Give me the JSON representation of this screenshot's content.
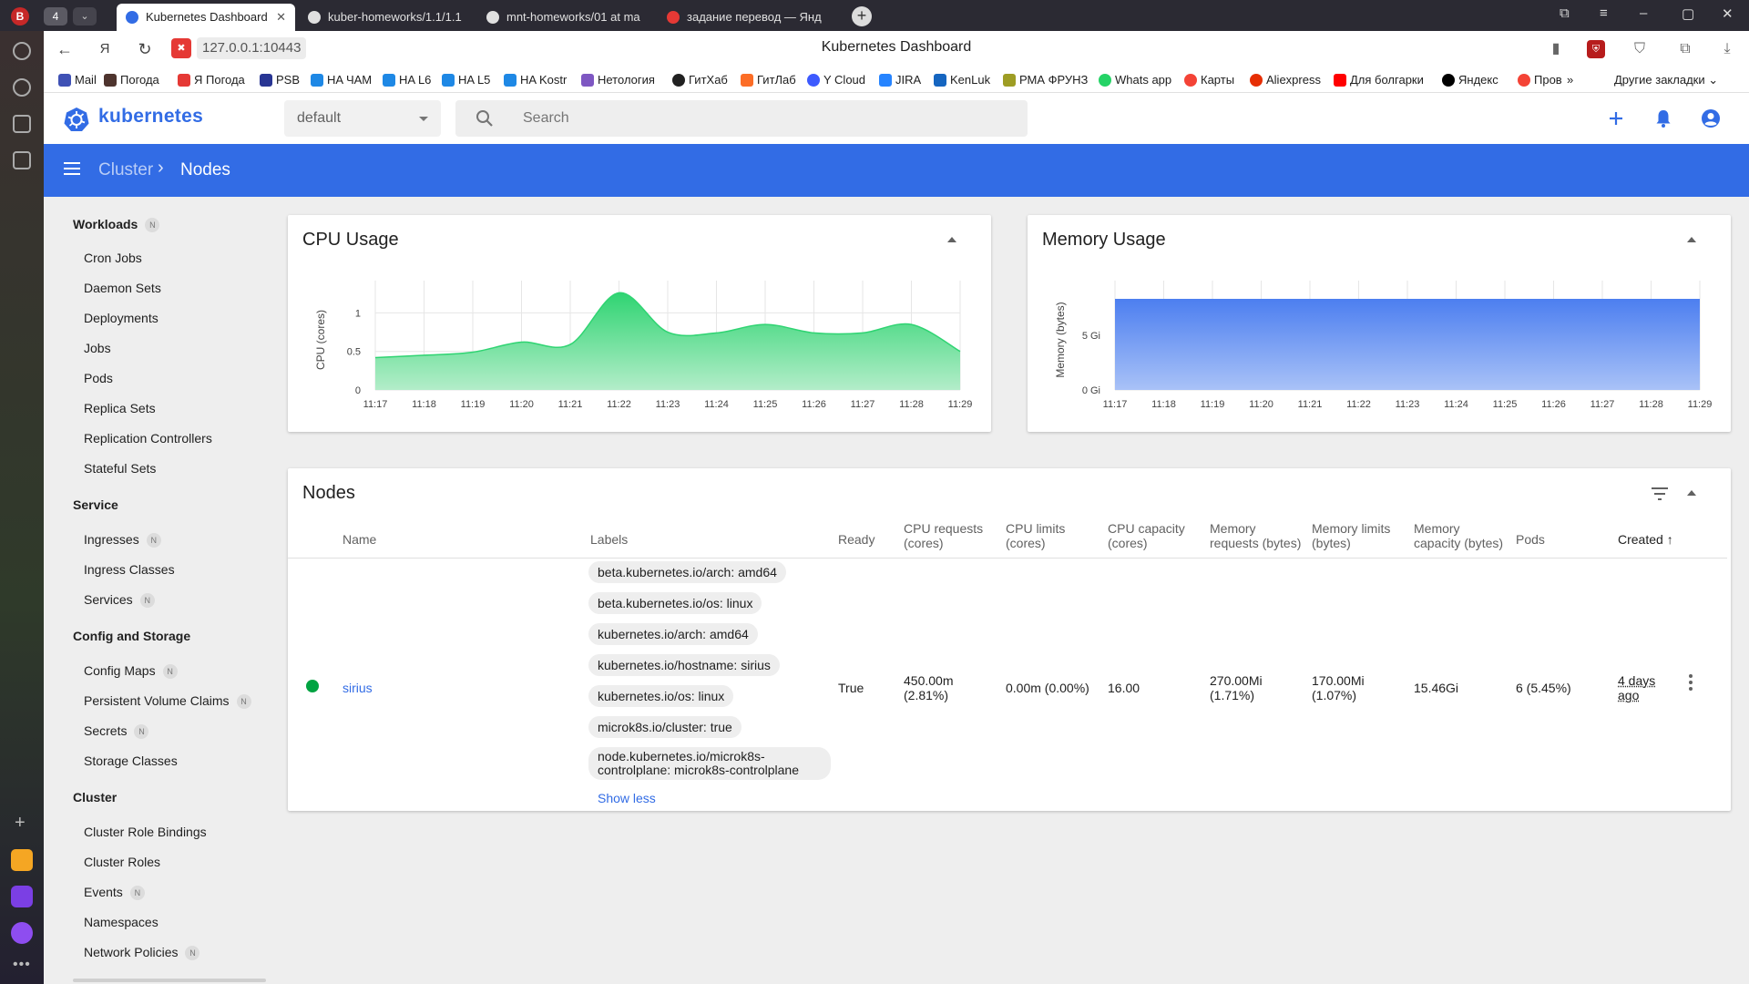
{
  "browser": {
    "profile_letter": "B",
    "tab_count": "4",
    "tabs": [
      {
        "label": "Kubernetes Dashboard",
        "active": true
      },
      {
        "label": "kuber-homeworks/1.1/1.1",
        "active": false
      },
      {
        "label": "mnt-homeworks/01 at ma",
        "active": false
      },
      {
        "label": "задание перевод — Янд",
        "active": false
      }
    ],
    "url": "127.0.0.1:10443",
    "page_title": "Kubernetes Dashboard",
    "bookmarks": [
      "Mail",
      "Погода",
      "Я Погода",
      "PSB",
      "HA ЧАМ",
      "HA L6",
      "HA L5",
      "HA Kostr",
      "Нетология",
      "ГитХаб",
      "ГитЛаб",
      "Y Cloud",
      "JIRA",
      "KenLuk",
      "РМА ФРУНЗ",
      "Whats app",
      "Карты",
      "Aliexpress",
      "Для болгарки",
      "Яндекс",
      "Пров"
    ],
    "bookmarks_more": "»",
    "other_bookmarks": "Другие закладки"
  },
  "app": {
    "brand": "kubernetes",
    "namespace": "default",
    "search_placeholder": "Search",
    "breadcrumb": {
      "parent": "Cluster",
      "separator": "›",
      "current": "Nodes"
    }
  },
  "sidebar": {
    "sections": [
      {
        "title": "Workloads",
        "badge": "N",
        "items": [
          {
            "label": "Cron Jobs"
          },
          {
            "label": "Daemon Sets"
          },
          {
            "label": "Deployments"
          },
          {
            "label": "Jobs"
          },
          {
            "label": "Pods"
          },
          {
            "label": "Replica Sets"
          },
          {
            "label": "Replication Controllers"
          },
          {
            "label": "Stateful Sets"
          }
        ]
      },
      {
        "title": "Service",
        "items": [
          {
            "label": "Ingresses",
            "badge": "N"
          },
          {
            "label": "Ingress Classes"
          },
          {
            "label": "Services",
            "badge": "N"
          }
        ]
      },
      {
        "title": "Config and Storage",
        "items": [
          {
            "label": "Config Maps",
            "badge": "N"
          },
          {
            "label": "Persistent Volume Claims",
            "badge": "N"
          },
          {
            "label": "Secrets",
            "badge": "N"
          },
          {
            "label": "Storage Classes"
          }
        ]
      },
      {
        "title": "Cluster",
        "items": [
          {
            "label": "Cluster Role Bindings"
          },
          {
            "label": "Cluster Roles"
          },
          {
            "label": "Events",
            "badge": "N"
          },
          {
            "label": "Namespaces"
          },
          {
            "label": "Network Policies",
            "badge": "N"
          }
        ]
      }
    ]
  },
  "chart_data": [
    {
      "type": "area",
      "title": "CPU Usage",
      "ylabel": "CPU (cores)",
      "xlabel": "",
      "x": [
        "11:17",
        "11:18",
        "11:19",
        "11:20",
        "11:21",
        "11:22",
        "11:23",
        "11:24",
        "11:25",
        "11:26",
        "11:27",
        "11:28",
        "11:29"
      ],
      "y": [
        0.42,
        0.45,
        0.49,
        0.62,
        0.59,
        1.26,
        0.75,
        0.74,
        0.85,
        0.74,
        0.74,
        0.85,
        0.5
      ],
      "yticks": [
        "0",
        "0.5",
        "1"
      ],
      "ylim": [
        0,
        1.3
      ],
      "grid": true,
      "color": "#00c752"
    },
    {
      "type": "area",
      "title": "Memory Usage",
      "ylabel": "Memory (bytes)",
      "xlabel": "",
      "x": [
        "11:17",
        "11:18",
        "11:19",
        "11:20",
        "11:21",
        "11:22",
        "11:23",
        "11:24",
        "11:25",
        "11:26",
        "11:27",
        "11:28",
        "11:29"
      ],
      "y_gi": [
        8.3,
        8.3,
        8.3,
        8.3,
        8.3,
        8.3,
        8.3,
        8.3,
        8.3,
        8.3,
        8.3,
        8.3,
        8.3
      ],
      "yticks": [
        "0 Gi",
        "5 Gi"
      ],
      "ylim_gi": [
        0,
        9.2
      ],
      "grid": true,
      "color": "#326ce5"
    }
  ],
  "nodes": {
    "title": "Nodes",
    "columns": {
      "name": "Name",
      "labels": "Labels",
      "ready": "Ready",
      "cpu_requests": [
        "CPU requests",
        "(cores)"
      ],
      "cpu_limits": [
        "CPU limits",
        "(cores)"
      ],
      "cpu_capacity": [
        "CPU capacity",
        "(cores)"
      ],
      "mem_requests": [
        "Memory",
        "requests (bytes)"
      ],
      "mem_limits": [
        "Memory limits",
        "(bytes)"
      ],
      "mem_capacity": [
        "Memory",
        "capacity (bytes)"
      ],
      "pods": "Pods",
      "created": "Created",
      "sort_arrow": "↑"
    },
    "row": {
      "name": "sirius",
      "labels": [
        "beta.kubernetes.io/arch: amd64",
        "beta.kubernetes.io/os: linux",
        "kubernetes.io/arch: amd64",
        "kubernetes.io/hostname: sirius",
        "kubernetes.io/os: linux",
        "microk8s.io/cluster: true",
        "node.kubernetes.io/microk8s-controlplane: microk8s-controlplane"
      ],
      "show_less": "Show less",
      "ready": "True",
      "cpu_requests": [
        "450.00m",
        "(2.81%)"
      ],
      "cpu_limits": "0.00m (0.00%)",
      "cpu_capacity": "16.00",
      "mem_requests": [
        "270.00Mi",
        "(1.71%)"
      ],
      "mem_limits": [
        "170.00Mi",
        "(1.07%)"
      ],
      "mem_capacity": "15.46Gi",
      "pods": "6 (5.45%)",
      "created": [
        "4 days",
        "ago"
      ]
    }
  }
}
